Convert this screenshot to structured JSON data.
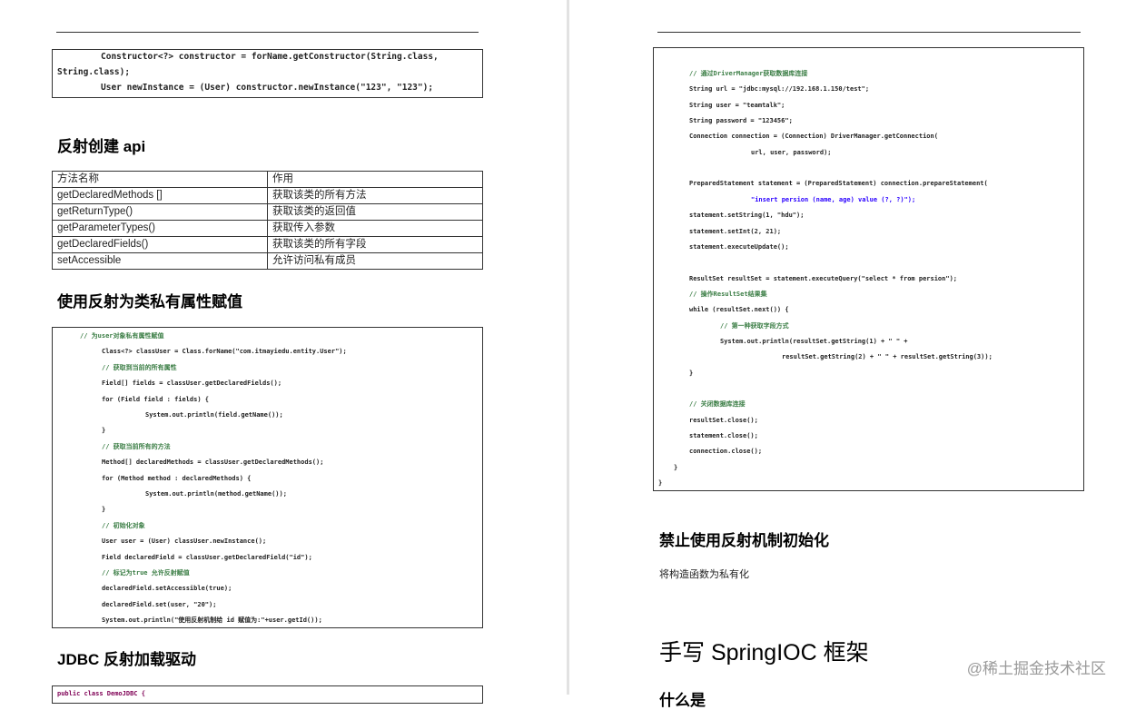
{
  "left": {
    "top_code": [
      {
        "i": 4,
        "t": "Constructor<?> constructor = forName.getConstructor(String.class,"
      },
      {
        "i": 0,
        "t": "String.class);"
      },
      {
        "i": 4,
        "t": "User newInstance = (User) constructor.newInstance(\"123\", \"123\");"
      }
    ],
    "heading_api": "反射创建 api",
    "table": {
      "headers": [
        "方法名称",
        "作用"
      ],
      "rows": [
        [
          "getDeclaredMethods []",
          "获取该类的所有方法"
        ],
        [
          "getReturnType()",
          "获取该类的返回值"
        ],
        [
          "getParameterTypes()",
          "获取传入参数"
        ],
        [
          "getDeclaredFields()",
          "获取该类的所有字段"
        ],
        [
          "setAccessible",
          "允许访问私有成员"
        ]
      ]
    },
    "heading_private": "使用反射为类私有属性赋值",
    "private_code": [
      {
        "i": 2,
        "k": "c",
        "t": "// 为user对象私有属性赋值"
      },
      {
        "i": 4,
        "t": "Class<?> classUser = Class.forName(\"com.itmayiedu.entity.User\");"
      },
      {
        "i": 4,
        "k": "c",
        "t": "// 获取到当前的所有属性"
      },
      {
        "i": 4,
        "t": "Field[] fields = classUser.getDeclaredFields();"
      },
      {
        "i": 4,
        "t": "for (Field field : fields) {"
      },
      {
        "i": 8,
        "t": "System.out.println(field.getName());"
      },
      {
        "i": 4,
        "t": "}"
      },
      {
        "i": 4,
        "k": "c",
        "t": "// 获取当前所有的方法"
      },
      {
        "i": 4,
        "t": "Method[] declaredMethods = classUser.getDeclaredMethods();"
      },
      {
        "i": 4,
        "t": "for (Method method : declaredMethods) {"
      },
      {
        "i": 8,
        "t": "System.out.println(method.getName());"
      },
      {
        "i": 4,
        "t": "}"
      },
      {
        "i": 4,
        "k": "c",
        "t": "// 初始化对象"
      },
      {
        "i": 4,
        "t": "User user = (User) classUser.newInstance();"
      },
      {
        "i": 4,
        "t": "Field declaredField = classUser.getDeclaredField(\"id\");"
      },
      {
        "i": 4,
        "k": "c",
        "t": "// 标记为true 允许反射赋值"
      },
      {
        "i": 4,
        "t": "declaredField.setAccessible(true);"
      },
      {
        "i": 4,
        "t": "declaredField.set(user, \"20\");"
      },
      {
        "i": 4,
        "t": "System.out.println(\"使用反射机制给 id 赋值为:\"+user.getId());"
      }
    ],
    "heading_jdbc": "JDBC 反射加载驱动",
    "jdbc_code_first": "public class DemoJDBC {"
  },
  "right": {
    "code": [
      {
        "i": 2,
        "k": "c",
        "t": "// 通过DriverManager获取数据库连接"
      },
      {
        "i": 2,
        "t": "String url = \"jdbc:mysql://192.168.1.150/test\";"
      },
      {
        "i": 2,
        "t": "String user = \"teamtalk\";"
      },
      {
        "i": 2,
        "t": "String password = \"123456\";"
      },
      {
        "i": 2,
        "t": "Connection connection = (Connection) DriverManager.getConnection("
      },
      {
        "i": 6,
        "t": "url, user, password);"
      },
      {
        "i": 2,
        "t": ""
      },
      {
        "i": 2,
        "t": "PreparedStatement statement = (PreparedStatement) connection.prepareStatement("
      },
      {
        "i": 6,
        "k": "s",
        "t": "\"insert persion (name, age) value (?, ?)\");"
      },
      {
        "i": 2,
        "t": "statement.setString(1, \"hdu\");"
      },
      {
        "i": 2,
        "t": "statement.setInt(2, 21);"
      },
      {
        "i": 2,
        "t": "statement.executeUpdate();"
      },
      {
        "i": 2,
        "t": ""
      },
      {
        "i": 2,
        "t": "ResultSet resultSet = statement.executeQuery(\"select * from persion\");"
      },
      {
        "i": 2,
        "k": "c",
        "t": "// 操作ResultSet结果集"
      },
      {
        "i": 2,
        "t": "while (resultSet.next()) {"
      },
      {
        "i": 4,
        "k": "c",
        "t": "// 第一种获取字段方式"
      },
      {
        "i": 4,
        "t": "System.out.println(resultSet.getString(1) + \" \" +"
      },
      {
        "i": 8,
        "t": "resultSet.getString(2) + \" \" + resultSet.getString(3));"
      },
      {
        "i": 2,
        "t": "}"
      },
      {
        "i": 2,
        "t": ""
      },
      {
        "i": 2,
        "k": "c",
        "t": "// 关闭数据库连接"
      },
      {
        "i": 2,
        "t": "resultSet.close();"
      },
      {
        "i": 2,
        "t": "statement.close();"
      },
      {
        "i": 2,
        "t": "connection.close();"
      },
      {
        "i": 1,
        "t": "}"
      },
      {
        "i": 0,
        "t": "}"
      }
    ],
    "heading_forbid": "禁止使用反射机制初始化",
    "forbid_text": "将构造函数为私有化",
    "heading_ioc": "手写 SpringIOC 框架",
    "heading_next": "什么是"
  },
  "watermark": "@稀土掘金技术社区"
}
